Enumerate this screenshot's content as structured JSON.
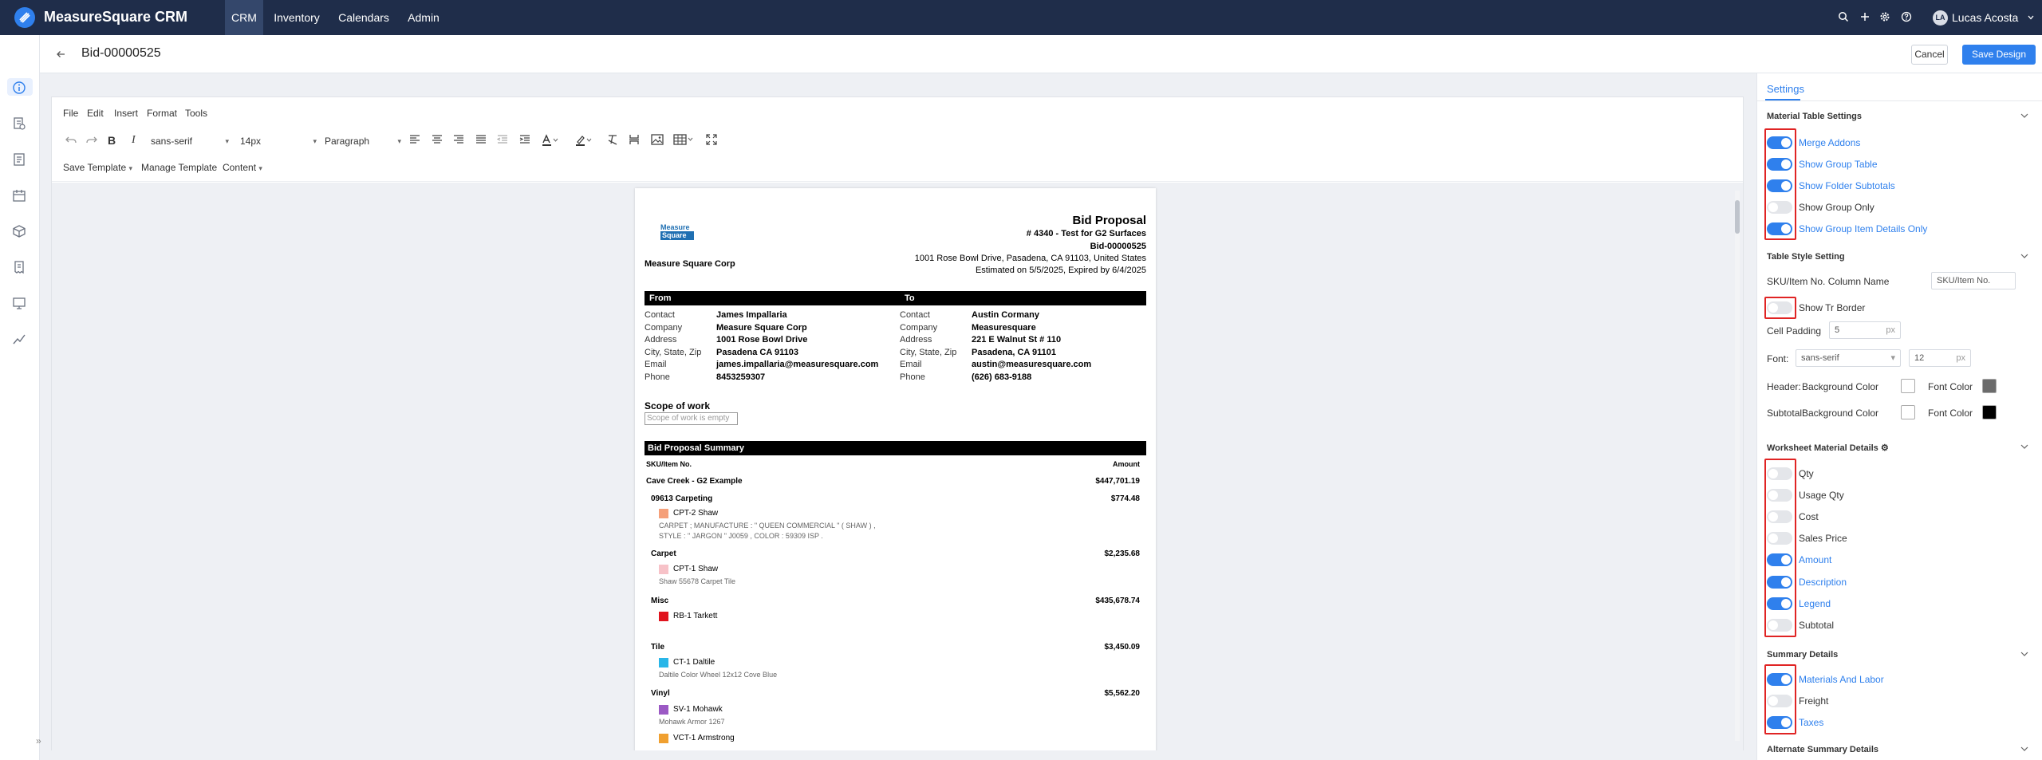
{
  "app": {
    "brand": "MeasureSquare CRM",
    "nav": [
      "CRM",
      "Inventory",
      "Calendars",
      "Admin"
    ],
    "user_initials": "LA",
    "user": "Lucas Acosta"
  },
  "header": {
    "title": "Bid-00000525",
    "cancel": "Cancel",
    "save": "Save Design"
  },
  "editor": {
    "menu": [
      "File",
      "Edit",
      "Insert",
      "Format",
      "Tools"
    ],
    "font_family": "sans-serif",
    "font_size": "14px",
    "block_format": "Paragraph",
    "template_menu": [
      "Save Template",
      "Manage Template",
      "Content"
    ]
  },
  "doc": {
    "logo_top": "Measure",
    "logo_bottom": "Square",
    "company": "Measure Square Corp",
    "title": "Bid Proposal",
    "subtitle": "# 4340 - Test for G2 Surfaces",
    "number": "Bid-00000525",
    "address": "1001 Rose Bowl Drive, Pasadena, CA 91103, United States",
    "estimate": "Estimated on 5/5/2025, Expired by 6/4/2025",
    "from_label": "From",
    "to_label": "To",
    "labels": [
      "Contact",
      "Company",
      "Address",
      "City, State, Zip",
      "Email",
      "Phone"
    ],
    "from": [
      "James Impallaria",
      "Measure Square Corp",
      "1001 Rose Bowl Drive",
      "Pasadena CA 91103",
      "james.impallaria@measuresquare.com",
      "8453259307"
    ],
    "to": [
      "Austin Cormany",
      "Measuresquare",
      "221 E Walnut St # 110",
      "Pasadena, CA 91101",
      "austin@measuresquare.com",
      "(626) 683-9188"
    ],
    "scope_title": "Scope of work",
    "scope_empty": "Scope of work is empty",
    "summary_title": "Bid Proposal Summary",
    "col_sku": "SKU/Item No.",
    "col_amount": "Amount",
    "group": {
      "name": "Cave Creek - G2 Example",
      "amount": "$447,701.19"
    },
    "folders": [
      {
        "name": "09613 Carpeting",
        "amount": "$774.48"
      },
      {
        "name": "Carpet",
        "amount": "$2,235.68"
      },
      {
        "name": "Misc",
        "amount": "$435,678.74"
      },
      {
        "name": "Tile",
        "amount": "$3,450.09"
      },
      {
        "name": "Vinyl",
        "amount": "$5,562.20"
      }
    ],
    "items": [
      {
        "name": "CPT-2 Shaw",
        "color": "#f5a07a",
        "desc": [
          "CARPET ; MANUFACTURE : \" QUEEN COMMERCIAL \" ( SHAW ) ,",
          "STYLE : \" JARGON \" J0059 , COLOR : 59309 ISP ."
        ]
      },
      {
        "name": "CPT-1 Shaw",
        "color": "#f7c2c8",
        "desc": [
          "Shaw 55678 Carpet Tile"
        ]
      },
      {
        "name": "RB-1 Tarkett",
        "color": "#e0141e",
        "desc": []
      },
      {
        "name": "CT-1 Daltile",
        "color": "#29b6e8",
        "desc": [
          "Daltile Color Wheel 12x12 Cove Blue"
        ]
      },
      {
        "name": "SV-1 Mohawk",
        "color": "#9b59c4",
        "desc": [
          "Mohawk Armor 1267"
        ]
      },
      {
        "name": "VCT-1 Armstrong",
        "color": "#f0a030",
        "desc": []
      }
    ]
  },
  "panel": {
    "tab": "Settings",
    "material_table": {
      "title": "Material Table Settings",
      "toggles": [
        {
          "label": "Merge Addons",
          "on": true
        },
        {
          "label": "Show Group Table",
          "on": true
        },
        {
          "label": "Show Folder Subtotals",
          "on": true
        },
        {
          "label": "Show Group Only",
          "on": false
        },
        {
          "label": "Show Group Item Details Only",
          "on": true
        }
      ]
    },
    "table_style": {
      "title": "Table Style Setting",
      "sku_label": "SKU/Item No. Column Name",
      "sku_placeholder": "SKU/Item No.",
      "tr_border": {
        "label": "Show Tr Border",
        "on": false
      },
      "cell_padding_label": "Cell Padding",
      "cell_padding": "5",
      "px": "px",
      "font_label": "Font:",
      "font": "sans-serif",
      "font_size": "12",
      "header_label": "Header:",
      "subtotal_label": "Subtotal:",
      "bg_color": "Background Color",
      "font_color": "Font Color",
      "header_bg": "#ffffff",
      "header_font": "#6b6b6b",
      "subtotal_bg": "#ffffff",
      "subtotal_font": "#000000"
    },
    "worksheet": {
      "title": "Worksheet Material Details",
      "toggles": [
        {
          "label": "Qty",
          "on": false
        },
        {
          "label": "Usage Qty",
          "on": false
        },
        {
          "label": "Cost",
          "on": false
        },
        {
          "label": "Sales Price",
          "on": false
        },
        {
          "label": "Amount",
          "on": true
        },
        {
          "label": "Description",
          "on": true
        },
        {
          "label": "Legend",
          "on": true
        },
        {
          "label": "Subtotal",
          "on": false
        }
      ]
    },
    "summary": {
      "title": "Summary Details",
      "toggles": [
        {
          "label": "Materials And Labor",
          "on": true
        },
        {
          "label": "Freight",
          "on": false
        },
        {
          "label": "Taxes",
          "on": true
        }
      ]
    },
    "alternate_title": "Alternate Summary Details"
  }
}
